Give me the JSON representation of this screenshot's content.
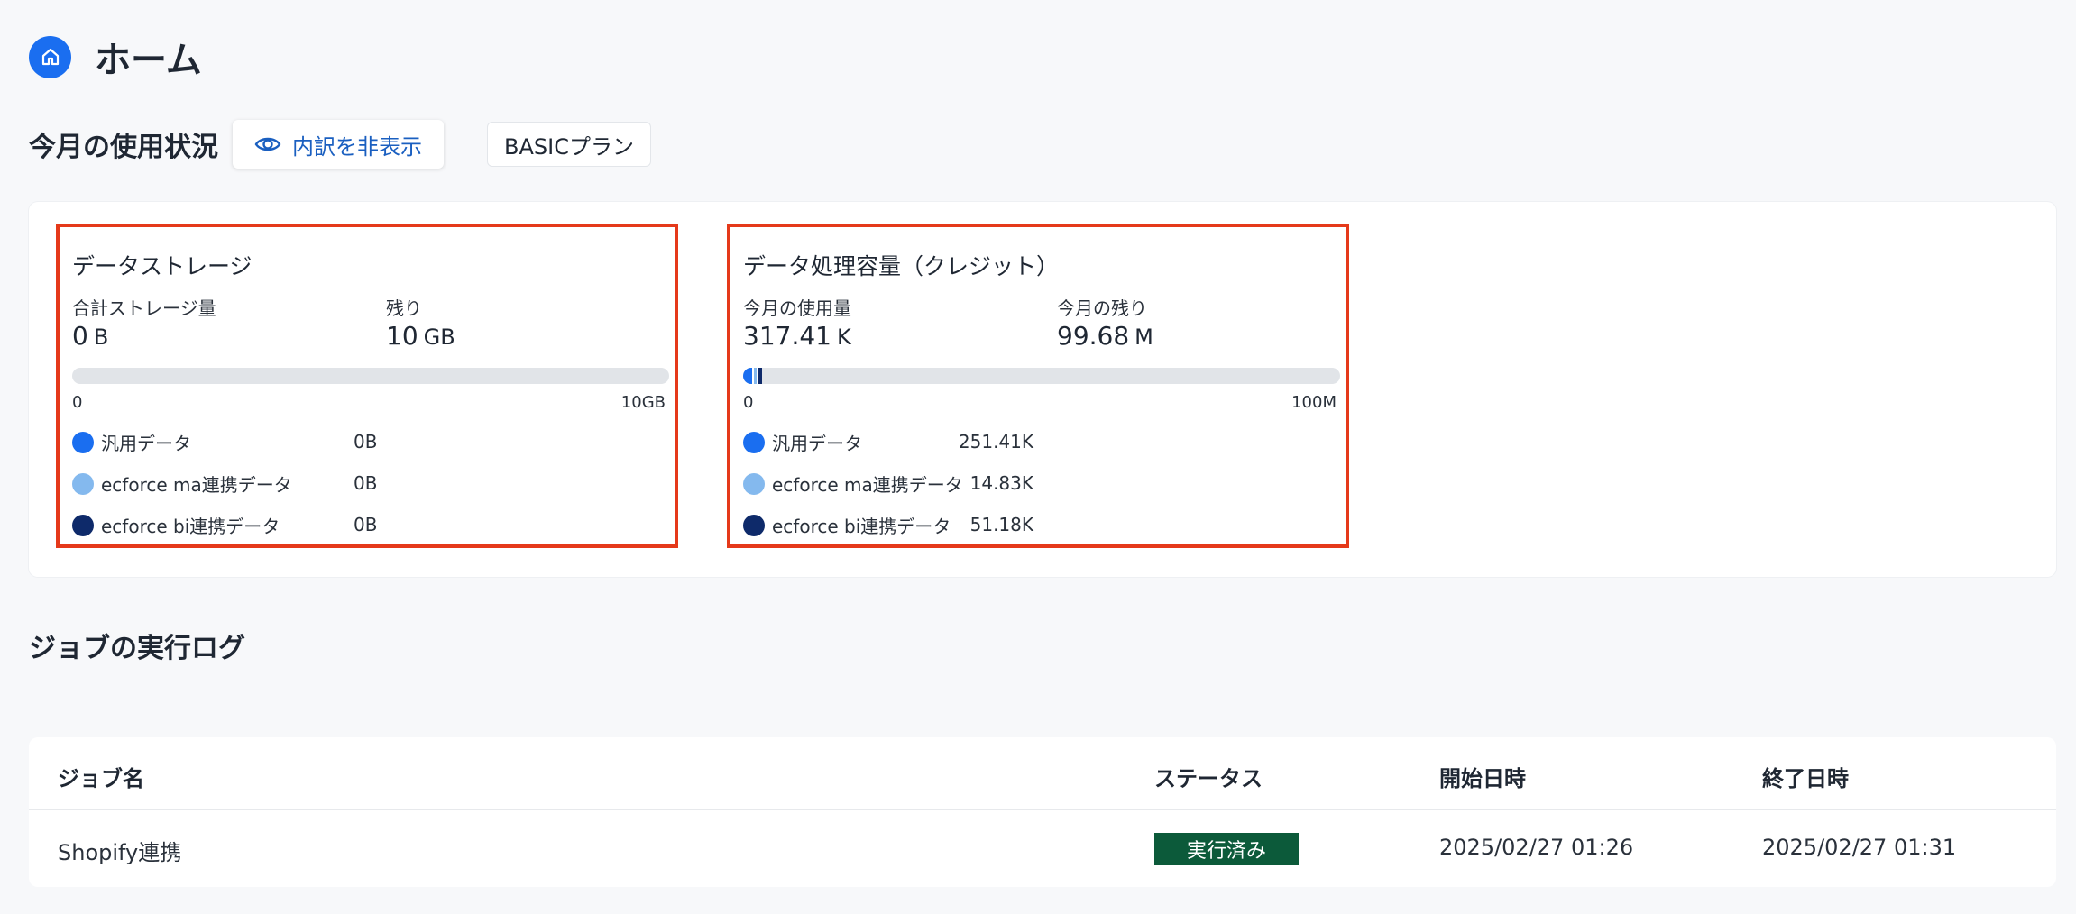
{
  "header": {
    "title": "ホーム",
    "icon": "home-icon"
  },
  "usage": {
    "section_title": "今月の使用状況",
    "toggle_label": "内訳を非表示",
    "toggle_icon": "eye-icon",
    "plan": "BASICプラン",
    "storage": {
      "title": "データストレージ",
      "total_label": "合計ストレージ量",
      "total_value": "0",
      "total_unit": "B",
      "remaining_label": "残り",
      "remaining_value": "10",
      "remaining_unit": "GB",
      "axis_min": "0",
      "axis_max": "10GB",
      "fill_fraction": 0.0,
      "legend": [
        {
          "label": "汎用データ",
          "value": "0B",
          "color": "#1a6ef0"
        },
        {
          "label": "ecforce ma連携データ",
          "value": "0B",
          "color": "#84b9ee"
        },
        {
          "label": "ecforce bi連携データ",
          "value": "0B",
          "color": "#0e2a6a"
        }
      ]
    },
    "credit": {
      "title": "データ処理容量（クレジット）",
      "used_label": "今月の使用量",
      "used_value": "317.41",
      "used_unit": "K",
      "remaining_label": "今月の残り",
      "remaining_value": "99.68",
      "remaining_unit": "M",
      "axis_min": "0",
      "axis_max": "100M",
      "legend": [
        {
          "label": "汎用データ",
          "value": "251.41K",
          "color": "#1a6ef0"
        },
        {
          "label": "ecforce ma連携データ",
          "value": "14.83K",
          "color": "#84b9ee"
        },
        {
          "label": "ecforce bi連携データ",
          "value": "51.18K",
          "color": "#0e2a6a"
        }
      ]
    }
  },
  "jobs": {
    "title": "ジョブの実行ログ",
    "columns": [
      "ジョブ名",
      "ステータス",
      "開始日時",
      "終了日時"
    ],
    "rows": [
      {
        "name": "Shopify連携",
        "status": "実行済み",
        "start": "2025/02/27 01:26",
        "end": "2025/02/27 01:31"
      }
    ]
  }
}
